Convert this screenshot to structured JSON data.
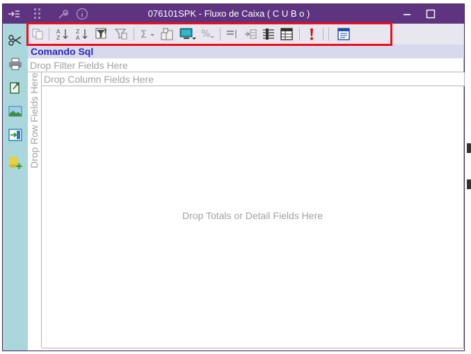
{
  "window": {
    "title": "076101SPK - Fluxo de Caixa ( C U B o )"
  },
  "titlebar_icons": [
    "sidebar-toggle-icon",
    "grid-icon",
    "wrench-icon",
    "info-icon"
  ],
  "window_controls": [
    "minimize-icon",
    "maximize-icon"
  ],
  "left_tools": [
    "scissors-icon",
    "printer-icon",
    "export-icon",
    "picture-icon",
    "import-icon",
    "add-database-icon"
  ],
  "toolbar": {
    "icons": [
      "copy-icon",
      "sort-ascending-icon",
      "sort-descending-icon",
      "filter-icon",
      "clear-filter-icon",
      "sum-icon",
      "field-list-icon",
      "chart-icon",
      "percent-icon",
      "collapse-row-icon",
      "expand-row-icon",
      "insert-column-icon",
      "grid-settings-icon",
      "alert-icon",
      "export-report-icon"
    ]
  },
  "pivot": {
    "command_label": "Comando Sql",
    "filter_placeholder": "Drop Filter Fields Here",
    "column_placeholder": "Drop Column Fields Here",
    "row_placeholder": "Drop Row Fields Here",
    "data_placeholder": "Drop Totals or Detail Fields Here"
  },
  "colors": {
    "titlebar": "#5e3380",
    "leftbar": "#a9d7dc",
    "highlight": "#e8101c",
    "command_text": "#2a2ab8"
  }
}
